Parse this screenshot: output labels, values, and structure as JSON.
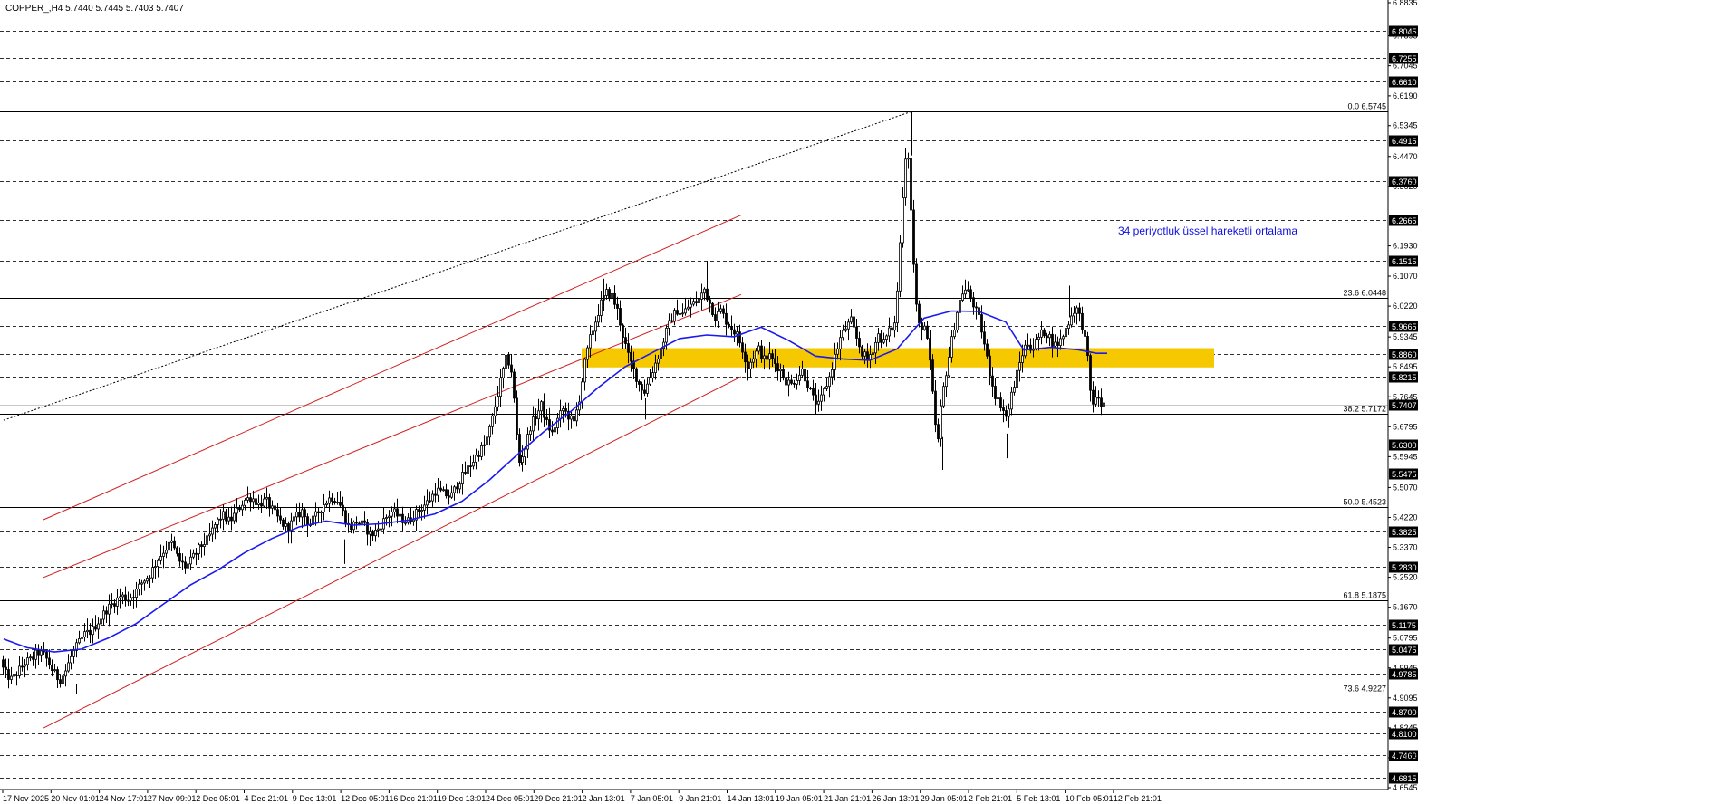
{
  "chart_data": {
    "type": "candlestick",
    "title": "COPPER_,H4 5.7440 5.7445 5.7403 5.7407",
    "symbol": "COPPER_",
    "timeframe": "H4",
    "ohlc_header": {
      "open": 5.744,
      "high": 5.7445,
      "low": 5.7403,
      "close": 5.7407
    },
    "current_price": "5.7407",
    "ylim": [
      4.6545,
      6.8835
    ],
    "y_tick_labels": [
      "6.8835",
      "6.7895",
      "6.7045",
      "6.6190",
      "6.5345",
      "6.4470",
      "6.3620",
      "6.1930",
      "6.1070",
      "6.0220",
      "5.9345",
      "5.8495",
      "5.7645",
      "5.6795",
      "5.5945",
      "5.5070",
      "5.4220",
      "5.3370",
      "5.2520",
      "5.1670",
      "5.0795",
      "4.9945",
      "4.9095",
      "4.8245",
      "4.7395",
      "4.6545"
    ],
    "y_tick_values": [
      6.8835,
      6.7895,
      6.7045,
      6.619,
      6.5345,
      6.447,
      6.362,
      6.193,
      6.107,
      6.022,
      5.9345,
      5.8495,
      5.7645,
      5.6795,
      5.5945,
      5.507,
      5.422,
      5.337,
      5.252,
      5.167,
      5.0795,
      4.9945,
      4.9095,
      4.8245,
      4.7395,
      4.6545
    ],
    "horizontal_levels": [
      {
        "value": 6.8045,
        "label": "6.8045"
      },
      {
        "value": 6.7255,
        "label": "6.7255"
      },
      {
        "value": 6.661,
        "label": "6.6610"
      },
      {
        "value": 6.4915,
        "label": "6.4915"
      },
      {
        "value": 6.376,
        "label": "6.3760"
      },
      {
        "value": 6.2665,
        "label": "6.2665"
      },
      {
        "value": 6.1515,
        "label": "6.1515"
      },
      {
        "value": 5.9665,
        "label": "5.9665"
      },
      {
        "value": 5.886,
        "label": "5.8860"
      },
      {
        "value": 5.8215,
        "label": "5.8215"
      },
      {
        "value": 5.63,
        "label": "5.6300"
      },
      {
        "value": 5.5475,
        "label": "5.5475"
      },
      {
        "value": 5.3825,
        "label": "5.3825"
      },
      {
        "value": 5.283,
        "label": "5.2830"
      },
      {
        "value": 5.1175,
        "label": "5.1175"
      },
      {
        "value": 5.0475,
        "label": "5.0475"
      },
      {
        "value": 4.9785,
        "label": "4.9785"
      },
      {
        "value": 4.87,
        "label": "4.8700"
      },
      {
        "value": 4.81,
        "label": "4.8100"
      },
      {
        "value": 4.746,
        "label": "4.7460"
      },
      {
        "value": 4.6815,
        "label": "4.6815"
      }
    ],
    "fibonacci_levels": [
      {
        "value": 6.5745,
        "label": "0.0 6.5745"
      },
      {
        "value": 6.0448,
        "label": "23.6 6.0448"
      },
      {
        "value": 5.7172,
        "label": "38.2 5.7172"
      },
      {
        "value": 5.4523,
        "label": "50.0 5.4523"
      },
      {
        "value": 5.1875,
        "label": "61.8 5.1875"
      },
      {
        "value": 4.9227,
        "label": "73.6 4.9227"
      }
    ],
    "x_tick_labels": [
      "17 Nov 2025",
      "20 Nov 01:01",
      "24 Nov 17:01",
      "27 Nov 09:01",
      "2 Dec 05:01",
      "4 Dec 21:01",
      "9 Dec 13:01",
      "12 Dec 05:01",
      "16 Dec 21:01",
      "19 Dec 13:01",
      "24 Dec 05:01",
      "29 Dec 21:01",
      "2 Jan 13:01",
      "7 Jan 05:01",
      "9 Jan 21:01",
      "14 Jan 13:01",
      "19 Jan 05:01",
      "21 Jan 21:01",
      "26 Jan 13:01",
      "29 Jan 05:01",
      "2 Feb 21:01",
      "5 Feb 13:01",
      "10 Feb 05:01",
      "12 Feb 21:01"
    ],
    "annotation": "34 periyotluk üssel hareketli ortalama",
    "price_path": [
      [
        0,
        5.03
      ],
      [
        8,
        4.98
      ],
      [
        16,
        4.96
      ],
      [
        24,
        4.99
      ],
      [
        30,
        5.01
      ],
      [
        38,
        5.02
      ],
      [
        44,
        5.04
      ],
      [
        52,
        5.03
      ],
      [
        60,
        4.99
      ],
      [
        68,
        4.96
      ],
      [
        74,
        4.98
      ],
      [
        80,
        5.02
      ],
      [
        88,
        5.06
      ],
      [
        96,
        5.09
      ],
      [
        104,
        5.1
      ],
      [
        112,
        5.13
      ],
      [
        120,
        5.16
      ],
      [
        128,
        5.18
      ],
      [
        136,
        5.2
      ],
      [
        144,
        5.19
      ],
      [
        152,
        5.21
      ],
      [
        160,
        5.24
      ],
      [
        168,
        5.26
      ],
      [
        176,
        5.3
      ],
      [
        184,
        5.33
      ],
      [
        192,
        5.35
      ],
      [
        200,
        5.3
      ],
      [
        208,
        5.28
      ],
      [
        216,
        5.31
      ],
      [
        224,
        5.34
      ],
      [
        232,
        5.36
      ],
      [
        240,
        5.4
      ],
      [
        248,
        5.43
      ],
      [
        256,
        5.41
      ],
      [
        264,
        5.44
      ],
      [
        272,
        5.47
      ],
      [
        280,
        5.48
      ],
      [
        288,
        5.46
      ],
      [
        296,
        5.47
      ],
      [
        304,
        5.44
      ],
      [
        312,
        5.41
      ],
      [
        320,
        5.39
      ],
      [
        328,
        5.42
      ],
      [
        336,
        5.44
      ],
      [
        344,
        5.4
      ],
      [
        352,
        5.43
      ],
      [
        360,
        5.46
      ],
      [
        368,
        5.48
      ],
      [
        376,
        5.47
      ],
      [
        382,
        5.43
      ],
      [
        388,
        5.39
      ],
      [
        396,
        5.41
      ],
      [
        404,
        5.4
      ],
      [
        412,
        5.37
      ],
      [
        420,
        5.39
      ],
      [
        428,
        5.42
      ],
      [
        436,
        5.44
      ],
      [
        444,
        5.42
      ],
      [
        452,
        5.41
      ],
      [
        460,
        5.43
      ],
      [
        468,
        5.45
      ],
      [
        476,
        5.47
      ],
      [
        484,
        5.5
      ],
      [
        492,
        5.49
      ],
      [
        500,
        5.48
      ],
      [
        508,
        5.52
      ],
      [
        516,
        5.55
      ],
      [
        524,
        5.58
      ],
      [
        532,
        5.61
      ],
      [
        538,
        5.63
      ],
      [
        544,
        5.68
      ],
      [
        550,
        5.75
      ],
      [
        556,
        5.82
      ],
      [
        562,
        5.88
      ],
      [
        568,
        5.83
      ],
      [
        572,
        5.68
      ],
      [
        576,
        5.58
      ],
      [
        582,
        5.62
      ],
      [
        588,
        5.68
      ],
      [
        594,
        5.71
      ],
      [
        600,
        5.74
      ],
      [
        606,
        5.69
      ],
      [
        612,
        5.66
      ],
      [
        618,
        5.7
      ],
      [
        624,
        5.73
      ],
      [
        630,
        5.71
      ],
      [
        636,
        5.69
      ],
      [
        642,
        5.76
      ],
      [
        648,
        5.86
      ],
      [
        654,
        5.93
      ],
      [
        660,
        5.98
      ],
      [
        666,
        6.03
      ],
      [
        672,
        6.06
      ],
      [
        678,
        6.05
      ],
      [
        684,
        6.01
      ],
      [
        690,
        5.94
      ],
      [
        696,
        5.88
      ],
      [
        702,
        5.84
      ],
      [
        708,
        5.8
      ],
      [
        714,
        5.78
      ],
      [
        720,
        5.82
      ],
      [
        726,
        5.86
      ],
      [
        732,
        5.9
      ],
      [
        738,
        5.95
      ],
      [
        744,
        5.99
      ],
      [
        750,
        6.01
      ],
      [
        756,
        6.0
      ],
      [
        762,
        6.02
      ],
      [
        768,
        6.03
      ],
      [
        774,
        6.04
      ],
      [
        780,
        6.07
      ],
      [
        786,
        6.03
      ],
      [
        792,
        5.99
      ],
      [
        798,
        6.01
      ],
      [
        804,
        5.98
      ],
      [
        810,
        5.96
      ],
      [
        816,
        5.94
      ],
      [
        822,
        5.9
      ],
      [
        828,
        5.85
      ],
      [
        834,
        5.88
      ],
      [
        840,
        5.9
      ],
      [
        846,
        5.87
      ],
      [
        852,
        5.88
      ],
      [
        858,
        5.86
      ],
      [
        864,
        5.84
      ],
      [
        870,
        5.81
      ],
      [
        876,
        5.8
      ],
      [
        882,
        5.82
      ],
      [
        888,
        5.84
      ],
      [
        894,
        5.8
      ],
      [
        900,
        5.76
      ],
      [
        906,
        5.74
      ],
      [
        912,
        5.78
      ],
      [
        918,
        5.82
      ],
      [
        924,
        5.88
      ],
      [
        930,
        5.93
      ],
      [
        936,
        5.96
      ],
      [
        942,
        5.98
      ],
      [
        948,
        5.93
      ],
      [
        954,
        5.89
      ],
      [
        960,
        5.87
      ],
      [
        966,
        5.9
      ],
      [
        972,
        5.94
      ],
      [
        978,
        5.92
      ],
      [
        984,
        5.95
      ],
      [
        990,
        5.97
      ],
      [
        994,
        6.1
      ],
      [
        998,
        6.3
      ],
      [
        1001,
        6.42
      ],
      [
        1004,
        6.5
      ],
      [
        1007,
        6.35
      ],
      [
        1010,
        6.18
      ],
      [
        1014,
        6.02
      ],
      [
        1018,
        5.95
      ],
      [
        1022,
        5.98
      ],
      [
        1026,
        5.92
      ],
      [
        1030,
        5.84
      ],
      [
        1034,
        5.7
      ],
      [
        1038,
        5.64
      ],
      [
        1042,
        5.76
      ],
      [
        1046,
        5.82
      ],
      [
        1050,
        5.88
      ],
      [
        1054,
        5.94
      ],
      [
        1060,
        6.02
      ],
      [
        1066,
        6.07
      ],
      [
        1072,
        6.06
      ],
      [
        1078,
        6.02
      ],
      [
        1084,
        5.98
      ],
      [
        1090,
        5.9
      ],
      [
        1096,
        5.82
      ],
      [
        1102,
        5.76
      ],
      [
        1108,
        5.74
      ],
      [
        1114,
        5.7
      ],
      [
        1118,
        5.76
      ],
      [
        1124,
        5.82
      ],
      [
        1130,
        5.88
      ],
      [
        1136,
        5.92
      ],
      [
        1142,
        5.9
      ],
      [
        1148,
        5.93
      ],
      [
        1154,
        5.95
      ],
      [
        1160,
        5.94
      ],
      [
        1166,
        5.91
      ],
      [
        1172,
        5.92
      ],
      [
        1178,
        5.95
      ],
      [
        1184,
        5.99
      ],
      [
        1190,
        6.02
      ],
      [
        1196,
        5.98
      ],
      [
        1202,
        5.9
      ],
      [
        1206,
        5.78
      ],
      [
        1210,
        5.74
      ],
      [
        1214,
        5.77
      ],
      [
        1218,
        5.7407
      ]
    ],
    "ema_path": [
      [
        4,
        5.077
      ],
      [
        30,
        5.052
      ],
      [
        60,
        5.04
      ],
      [
        90,
        5.048
      ],
      [
        120,
        5.08
      ],
      [
        150,
        5.12
      ],
      [
        180,
        5.175
      ],
      [
        210,
        5.23
      ],
      [
        240,
        5.272
      ],
      [
        270,
        5.322
      ],
      [
        300,
        5.362
      ],
      [
        330,
        5.395
      ],
      [
        360,
        5.412
      ],
      [
        390,
        5.4
      ],
      [
        420,
        5.404
      ],
      [
        450,
        5.414
      ],
      [
        480,
        5.432
      ],
      [
        510,
        5.468
      ],
      [
        540,
        5.528
      ],
      [
        570,
        5.598
      ],
      [
        600,
        5.665
      ],
      [
        630,
        5.723
      ],
      [
        660,
        5.79
      ],
      [
        690,
        5.85
      ],
      [
        720,
        5.89
      ],
      [
        750,
        5.93
      ],
      [
        780,
        5.94
      ],
      [
        810,
        5.935
      ],
      [
        840,
        5.962
      ],
      [
        870,
        5.925
      ],
      [
        900,
        5.88
      ],
      [
        930,
        5.872
      ],
      [
        960,
        5.868
      ],
      [
        990,
        5.9
      ],
      [
        1020,
        5.988
      ],
      [
        1050,
        6.008
      ],
      [
        1080,
        6.007
      ],
      [
        1110,
        5.977
      ],
      [
        1130,
        5.897
      ],
      [
        1160,
        5.905
      ],
      [
        1190,
        5.898
      ],
      [
        1210,
        5.888
      ],
      [
        1222,
        5.888
      ]
    ],
    "channel_lines": [
      {
        "x1": 48,
        "y1": 5.4155,
        "x2": 818,
        "y2": 6.2805
      },
      {
        "x1": 48,
        "y1": 4.824,
        "x2": 818,
        "y2": 5.8215
      },
      {
        "x1": 48,
        "y1": 5.2515,
        "x2": 818,
        "y2": 6.0548
      }
    ],
    "trendline_dotted": {
      "x1": 4,
      "y1": 5.698,
      "x2": 1006,
      "y2": 6.5745
    },
    "highlight_zone": {
      "x1": 642,
      "x2": 1340,
      "y_low": 5.848,
      "y_high": 5.9027
    }
  },
  "colors": {
    "candles": "#000000",
    "ema": "#1a1af0",
    "channel": "#d02020",
    "zone": "#f5c800",
    "grid": "#303030",
    "badge_bg": "#000000",
    "badge_text": "#ffffff",
    "annotation": "#1010e0"
  }
}
